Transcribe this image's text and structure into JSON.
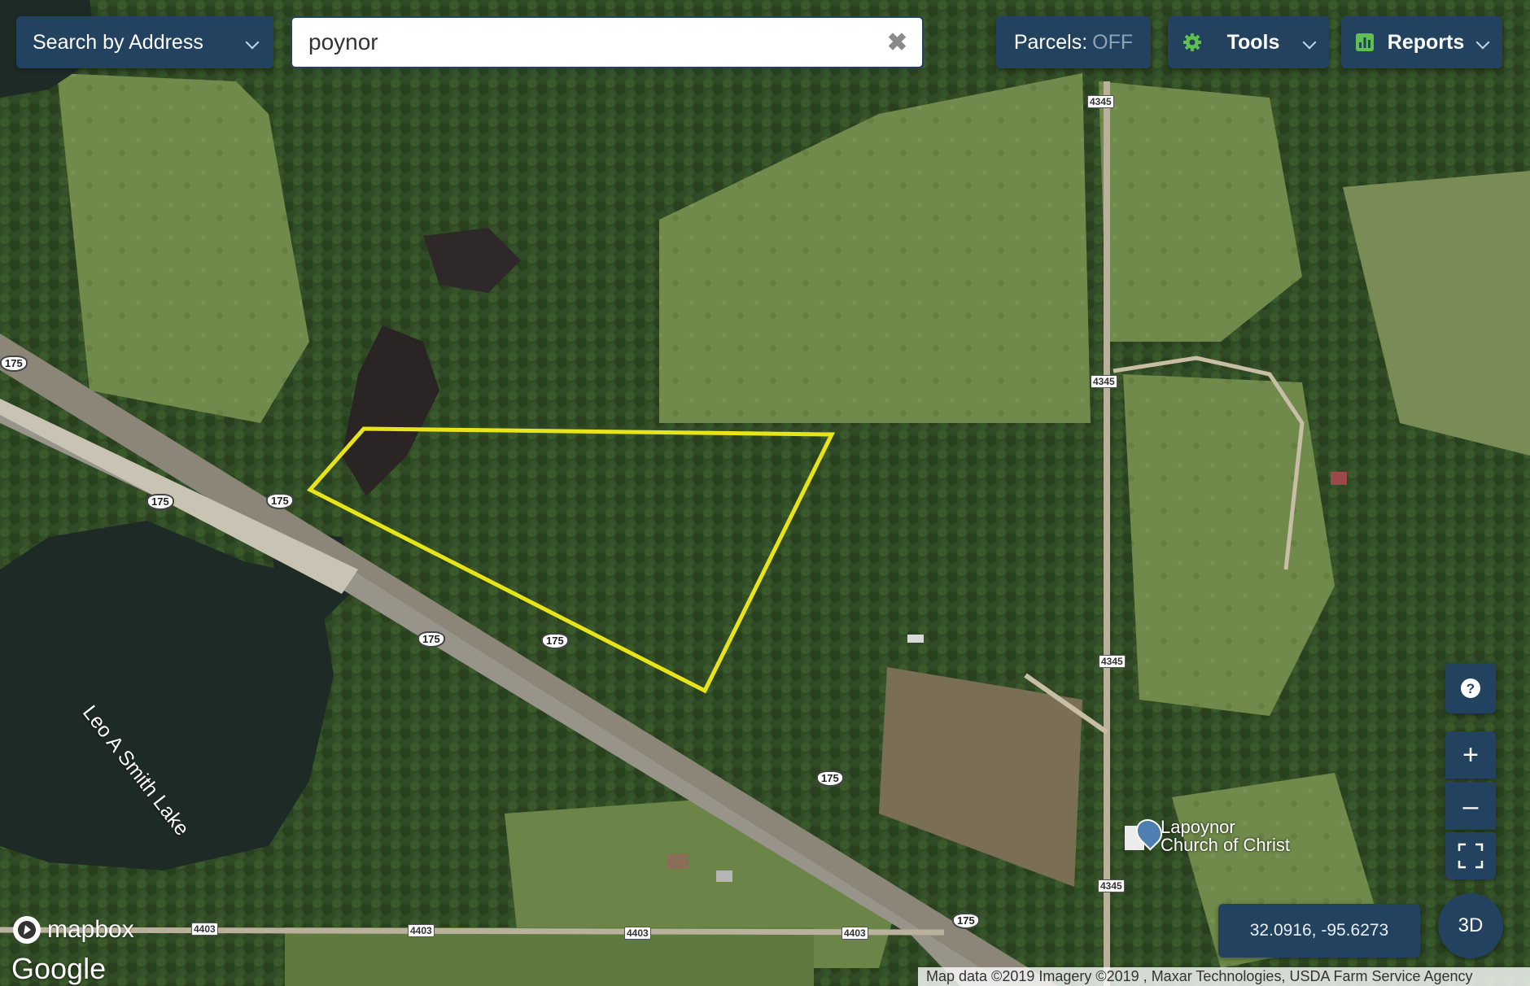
{
  "search": {
    "mode_label": "Search by Address",
    "query": "poynor"
  },
  "toolbar": {
    "parcels_label": "Parcels:",
    "parcels_state": "OFF",
    "tools_label": "Tools",
    "reports_label": "Reports"
  },
  "map": {
    "lake_label": "Leo A Smith Lake",
    "poi": {
      "line1": "Lapoynor",
      "line2": "Church of Christ"
    },
    "highway_shields": [
      "175",
      "175",
      "175",
      "175",
      "175",
      "175",
      "175"
    ],
    "road_4345": "4345",
    "road_4403": "4403",
    "parcel_outline_color": "#e8e41a"
  },
  "controls": {
    "zoom_in": "+",
    "zoom_out": "–",
    "three_d": "3D",
    "coordinates": "32.0916, -95.6273"
  },
  "branding": {
    "mapbox": "mapbox",
    "google": "Google"
  },
  "attribution": "Map data ©2019 Imagery ©2019 , Maxar Technologies, USDA Farm Service Agency"
}
